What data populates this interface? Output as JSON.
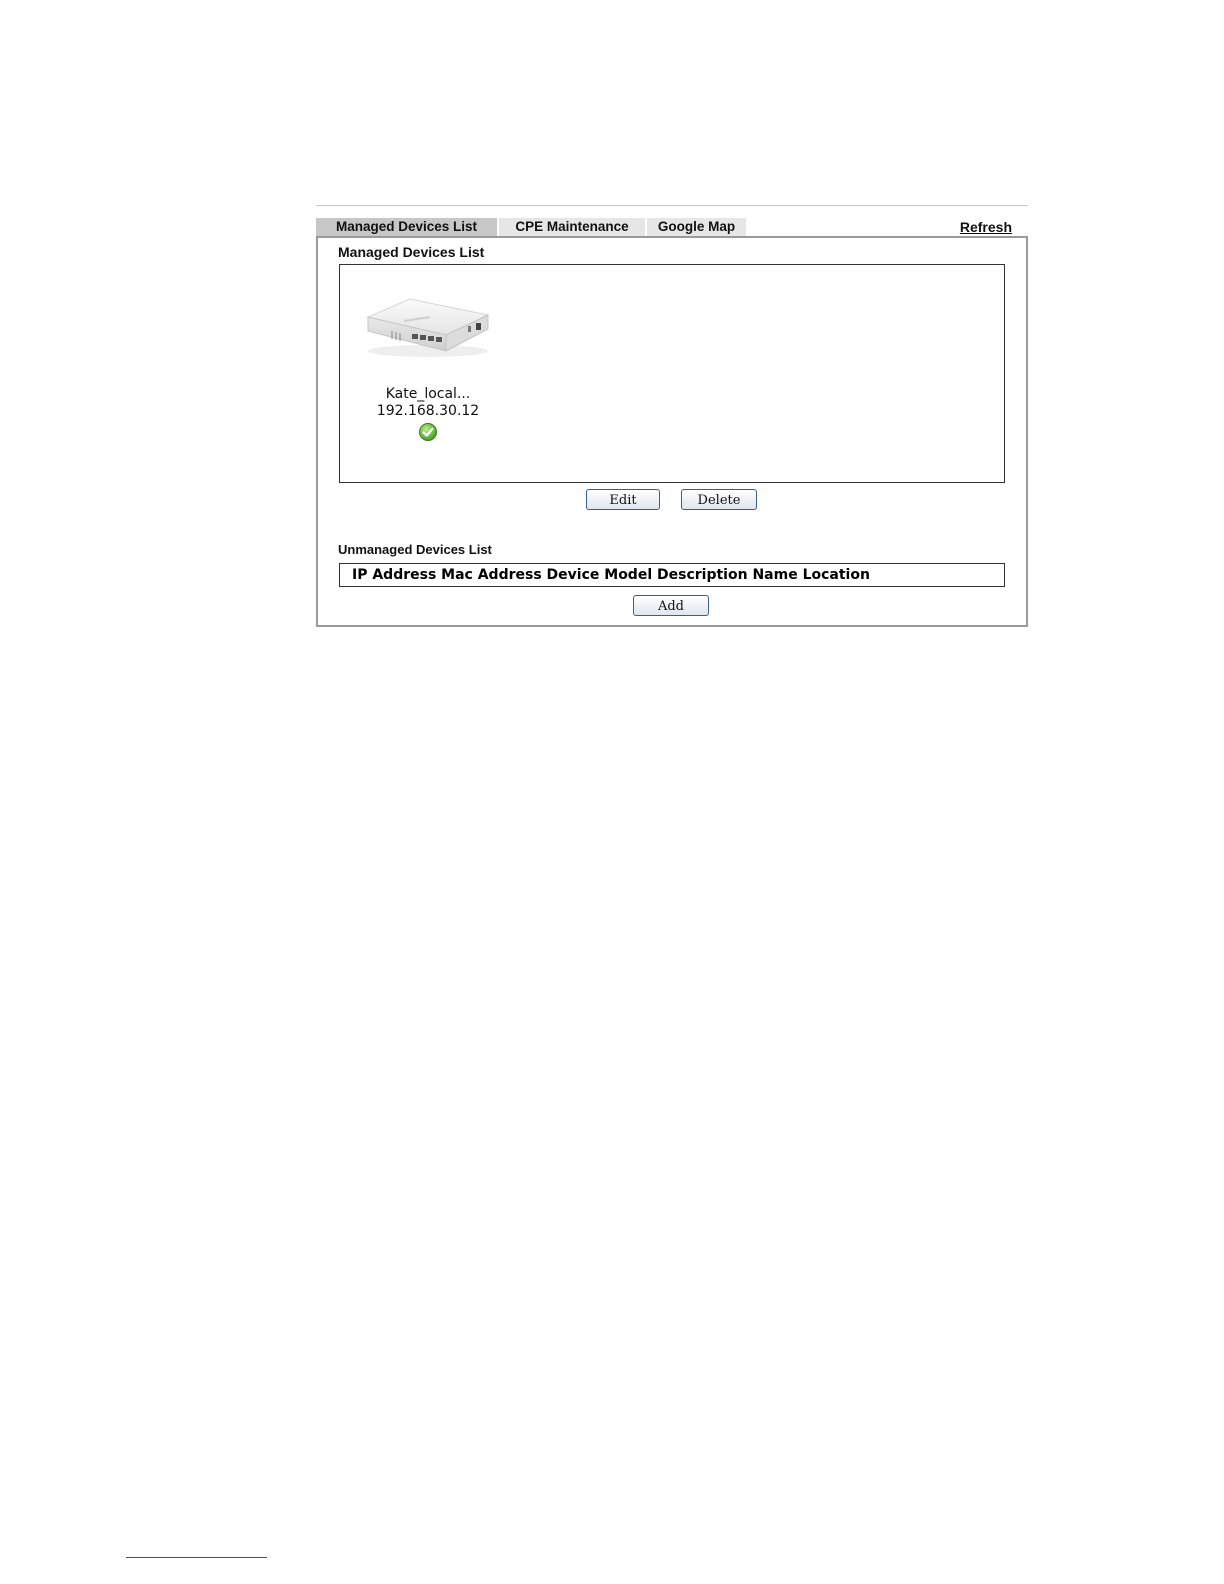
{
  "tabs": [
    {
      "label": "Managed Devices List",
      "active": true
    },
    {
      "label": "CPE Maintenance",
      "active": false
    },
    {
      "label": "Google Map",
      "active": false
    }
  ],
  "refresh_label": "Refresh",
  "managed": {
    "title": "Managed Devices List",
    "devices": [
      {
        "name": "Kate_local...",
        "ip": "192.168.30.12",
        "status_icon": "check-circle-icon",
        "image": "router-icon"
      }
    ],
    "edit_label": "Edit",
    "delete_label": "Delete"
  },
  "unmanaged": {
    "title": "Unmanaged Devices List",
    "columns": [
      "IP Address",
      "Mac Address",
      "Device Model",
      "Description",
      "Name",
      "Location"
    ],
    "add_label": "Add"
  },
  "colors": {
    "active_tab": "#c7c7c7",
    "inactive_tab": "#e6e6e6",
    "status_ok": "#5db12f"
  }
}
